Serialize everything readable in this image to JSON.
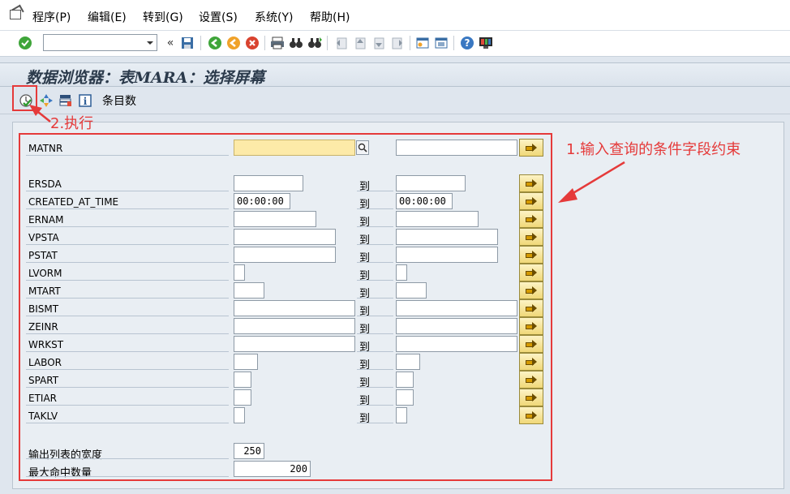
{
  "menu": [
    "程序(P)",
    "编辑(E)",
    "转到(G)",
    "设置(S)",
    "系统(Y)",
    "帮助(H)"
  ],
  "title": "数据浏览器：表MARA：选择屏幕",
  "app_toolbar": {
    "count_label": "条目数"
  },
  "to_label": "到",
  "fields": [
    {
      "name": "MATNR",
      "low": "",
      "high": ""
    },
    {
      "name": "ERSDA",
      "low": "",
      "high": ""
    },
    {
      "name": "CREATED_AT_TIME",
      "low": "00:00:00",
      "high": "00:00:00"
    },
    {
      "name": "ERNAM",
      "low": "",
      "high": ""
    },
    {
      "name": "VPSTA",
      "low": "",
      "high": ""
    },
    {
      "name": "PSTAT",
      "low": "",
      "high": ""
    },
    {
      "name": "LVORM",
      "low": "",
      "high": ""
    },
    {
      "name": "MTART",
      "low": "",
      "high": ""
    },
    {
      "name": "BISMT",
      "low": "",
      "high": ""
    },
    {
      "name": "ZEINR",
      "low": "",
      "high": ""
    },
    {
      "name": "WRKST",
      "low": "",
      "high": ""
    },
    {
      "name": "LABOR",
      "low": "",
      "high": ""
    },
    {
      "name": "SPART",
      "low": "",
      "high": ""
    },
    {
      "name": "ETIAR",
      "low": "",
      "high": ""
    },
    {
      "name": "TAKLV",
      "low": "",
      "high": ""
    }
  ],
  "output": {
    "width_label": "输出列表的宽度",
    "width_value": "250",
    "max_hits_label": "最大命中数量",
    "max_hits_value": "200"
  },
  "annotations": {
    "step1": "1.输入查询的条件字段约束",
    "step2": "2.执行"
  },
  "colors": {
    "annotation": "#e53a3a",
    "required_field": "#fdeaa8"
  }
}
